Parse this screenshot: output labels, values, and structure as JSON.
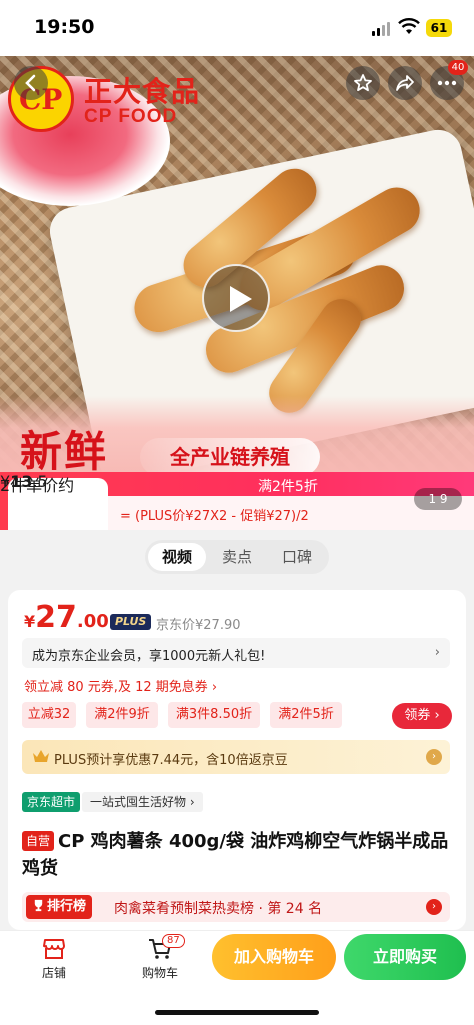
{
  "status_bar": {
    "time": "19:50",
    "battery": "61"
  },
  "hero": {
    "brand_cn": "正大食品",
    "brand_en": "CP FOOD",
    "logo_text": "CP",
    "more_badge": "40",
    "fresh_text": "新鲜",
    "chain_text": "全产业链养殖",
    "pager": "1 9"
  },
  "promo": {
    "unit_label": "2件单价约",
    "unit_currency": "¥",
    "unit_int": "13",
    "unit_dec": ".5",
    "deal_label": "满2件5折",
    "calc": "= (PLUS价¥27X2 - 促销¥27)/2"
  },
  "tabs": [
    "视频",
    "卖点",
    "口碑"
  ],
  "price": {
    "currency": "¥",
    "int": "27",
    "dec": ".00",
    "plus_badge": "PLUS",
    "jd_price": "京东价¥27.90"
  },
  "member_row": {
    "text": "成为京东企业会员，享1000元新人礼包!",
    "chevron": "›"
  },
  "coupon_line": "领立减 80 元券,及 12 期免息券 ›",
  "chips": [
    "立减32",
    "满2件9折",
    "满3件8.50折",
    "满2件5折"
  ],
  "claim_button": "领券 ›",
  "plus_row": {
    "text": "PLUS预计享优惠7.44元，含10倍返京豆",
    "go": "›"
  },
  "market": {
    "tag": "京东超市",
    "desc": "一站式囤生活好物 ›"
  },
  "product": {
    "self_tag": "自营",
    "title": "CP 鸡肉薯条 400g/袋 油炸鸡柳空气炸锅半成品鸡货"
  },
  "rank": {
    "tag": "排行榜",
    "text": "肉禽菜肴预制菜热卖榜 · 第 24 名",
    "go": "›"
  },
  "bottom_bar": {
    "store": "店铺",
    "cart": "购物车",
    "cart_count": "87",
    "add_cart": "加入购物车",
    "buy_now": "立即购买"
  }
}
